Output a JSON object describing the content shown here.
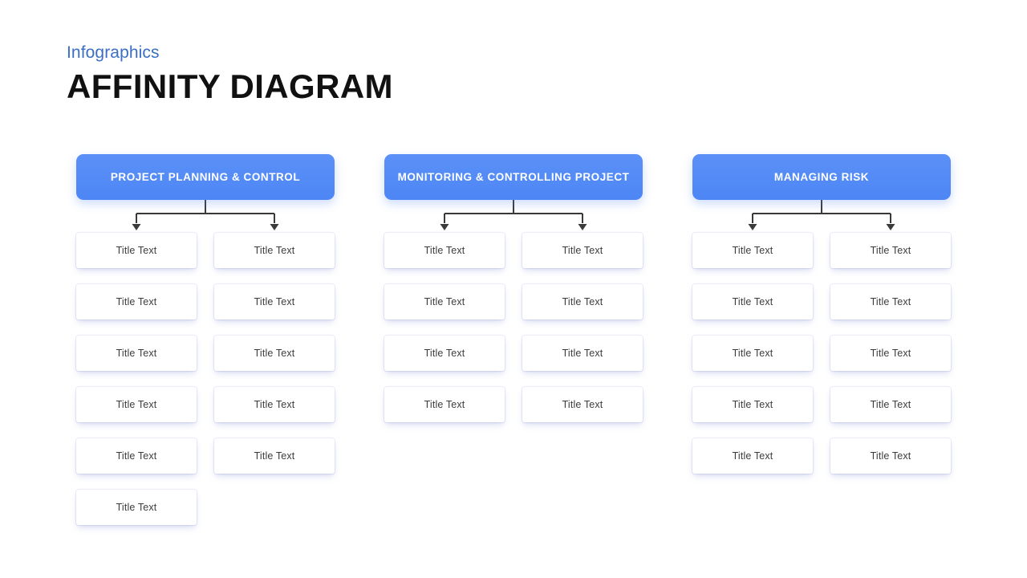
{
  "header": {
    "eyebrow": "Infographics",
    "title": "AFFINITY DIAGRAM",
    "eyebrow_color": "#3a6fc4",
    "title_color": "#111111"
  },
  "theme": {
    "background": "#ffffff",
    "accent_blue": "#5089f8",
    "header_gradient_from": "#5b90f7",
    "header_gradient_to": "#4d86f5",
    "card_background": "#ffffff",
    "card_text_color": "#3c3c3c",
    "card_shadow_color": "#8a94d7",
    "connector_color": "#3a3a3a"
  },
  "columns": [
    {
      "id": "project-planning-control",
      "header": "PROJECT PLANNING & CONTROL",
      "left_cards": [
        {
          "label": "Title Text"
        },
        {
          "label": "Title Text"
        },
        {
          "label": "Title Text"
        },
        {
          "label": "Title Text"
        },
        {
          "label": "Title Text"
        },
        {
          "label": "Title Text"
        }
      ],
      "right_cards": [
        {
          "label": "Title Text"
        },
        {
          "label": "Title Text"
        },
        {
          "label": "Title Text"
        },
        {
          "label": "Title Text"
        },
        {
          "label": "Title Text"
        }
      ]
    },
    {
      "id": "monitoring-controlling-project",
      "header": "MONITORING & CONTROLLING PROJECT",
      "left_cards": [
        {
          "label": "Title Text"
        },
        {
          "label": "Title Text"
        },
        {
          "label": "Title Text"
        },
        {
          "label": "Title Text"
        }
      ],
      "right_cards": [
        {
          "label": "Title Text"
        },
        {
          "label": "Title Text"
        },
        {
          "label": "Title Text"
        },
        {
          "label": "Title Text"
        }
      ]
    },
    {
      "id": "managing-risk",
      "header": "MANAGING RISK",
      "left_cards": [
        {
          "label": "Title Text"
        },
        {
          "label": "Title Text"
        },
        {
          "label": "Title Text"
        },
        {
          "label": "Title Text"
        },
        {
          "label": "Title Text"
        }
      ],
      "right_cards": [
        {
          "label": "Title Text"
        },
        {
          "label": "Title Text"
        },
        {
          "label": "Title Text"
        },
        {
          "label": "Title Text"
        },
        {
          "label": "Title Text"
        }
      ]
    }
  ]
}
